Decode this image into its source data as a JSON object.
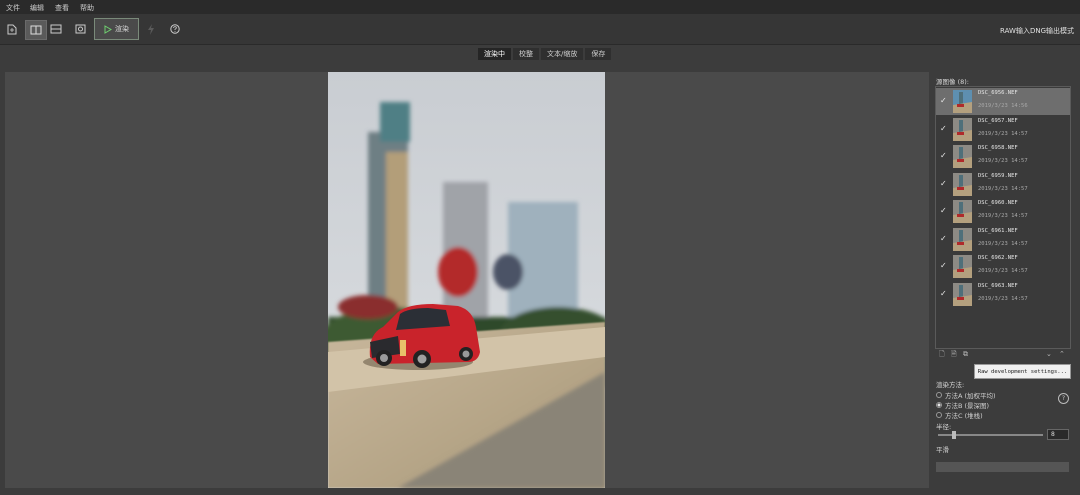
{
  "menu": [
    "文件",
    "编辑",
    "查看",
    "帮助"
  ],
  "toolbar": {
    "render_label": "渲染",
    "mode_label": "RAW输入DNG输出模式"
  },
  "tabs": [
    "渲染中",
    "校整",
    "文本/缩放",
    "保存"
  ],
  "panel": {
    "title": "源图像 (8):",
    "raw_settings": "Raw development settings...",
    "render_method_label": "渲染方法:",
    "methods": [
      {
        "label": "方法A (加权平均)",
        "selected": false
      },
      {
        "label": "方法B (景深图)",
        "selected": true
      },
      {
        "label": "方法C (堆栈)",
        "selected": false
      }
    ],
    "radius_label": "半径:",
    "radius_value": "8",
    "smooth_label": "平滑"
  },
  "files": [
    {
      "name": "DSC_6956.NEF",
      "date": "2019/3/23 14:56",
      "checked": true,
      "selected": true
    },
    {
      "name": "DSC_6957.NEF",
      "date": "2019/3/23 14:57",
      "checked": true,
      "selected": false
    },
    {
      "name": "DSC_6958.NEF",
      "date": "2019/3/23 14:57",
      "checked": true,
      "selected": false
    },
    {
      "name": "DSC_6959.NEF",
      "date": "2019/3/23 14:57",
      "checked": true,
      "selected": false
    },
    {
      "name": "DSC_6960.NEF",
      "date": "2019/3/23 14:57",
      "checked": true,
      "selected": false
    },
    {
      "name": "DSC_6961.NEF",
      "date": "2019/3/23 14:57",
      "checked": true,
      "selected": false
    },
    {
      "name": "DSC_6962.NEF",
      "date": "2019/3/23 14:57",
      "checked": true,
      "selected": false
    },
    {
      "name": "DSC_6963.NEF",
      "date": "2019/3/23 14:57",
      "checked": true,
      "selected": false
    }
  ],
  "colors": {
    "accent_render_border": "#7a8a7a",
    "selected_row": "#6e6e6e"
  }
}
